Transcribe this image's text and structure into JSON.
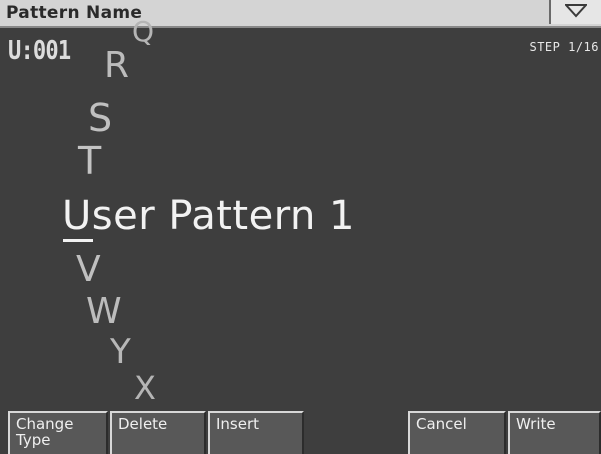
{
  "titlebar": {
    "title": "Pattern Name",
    "menu_icon": "triangle-down-icon"
  },
  "pattern": {
    "number": "U:001",
    "step": "STEP 1/16"
  },
  "char_wheel": {
    "above": [
      "Q",
      "R",
      "S",
      "T"
    ],
    "below": [
      "V",
      "W",
      "Y",
      "X"
    ]
  },
  "name": {
    "value": "User Pattern 1"
  },
  "function_buttons": {
    "change_type": "Change\nType",
    "delete": "Delete",
    "insert": "Insert",
    "cancel": "Cancel",
    "write": "Write"
  },
  "colors": {
    "background": "#3e3e3e",
    "titlebar": "#d4d4d4",
    "button": "#585858",
    "text": "#f2f2f2"
  }
}
